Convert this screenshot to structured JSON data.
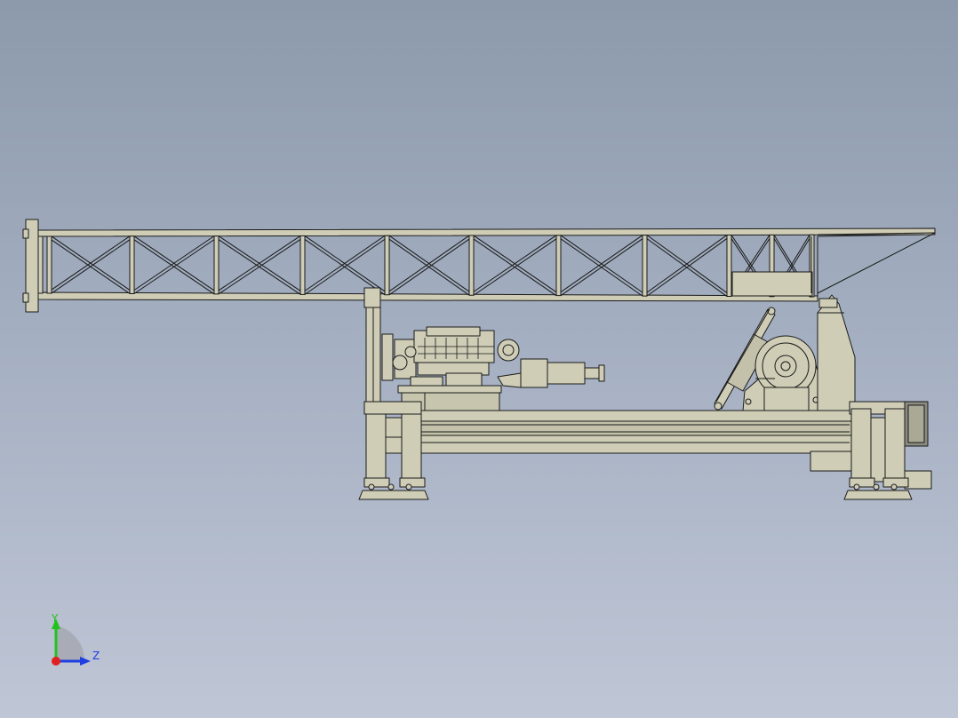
{
  "viewport": {
    "background_top": "#8c9aac",
    "background_bottom": "#bfc6d6"
  },
  "model": {
    "description_icon": "drilling-rig-side-view",
    "body_color": "#cfcdb6",
    "shade_color": "#b9b7a0",
    "edge_color": "#1a1a1a"
  },
  "triad": {
    "y_label": "Y",
    "z_label": "Z",
    "y_color": "#23c21f",
    "z_color": "#1f3de0",
    "x_color": "#e02020"
  }
}
